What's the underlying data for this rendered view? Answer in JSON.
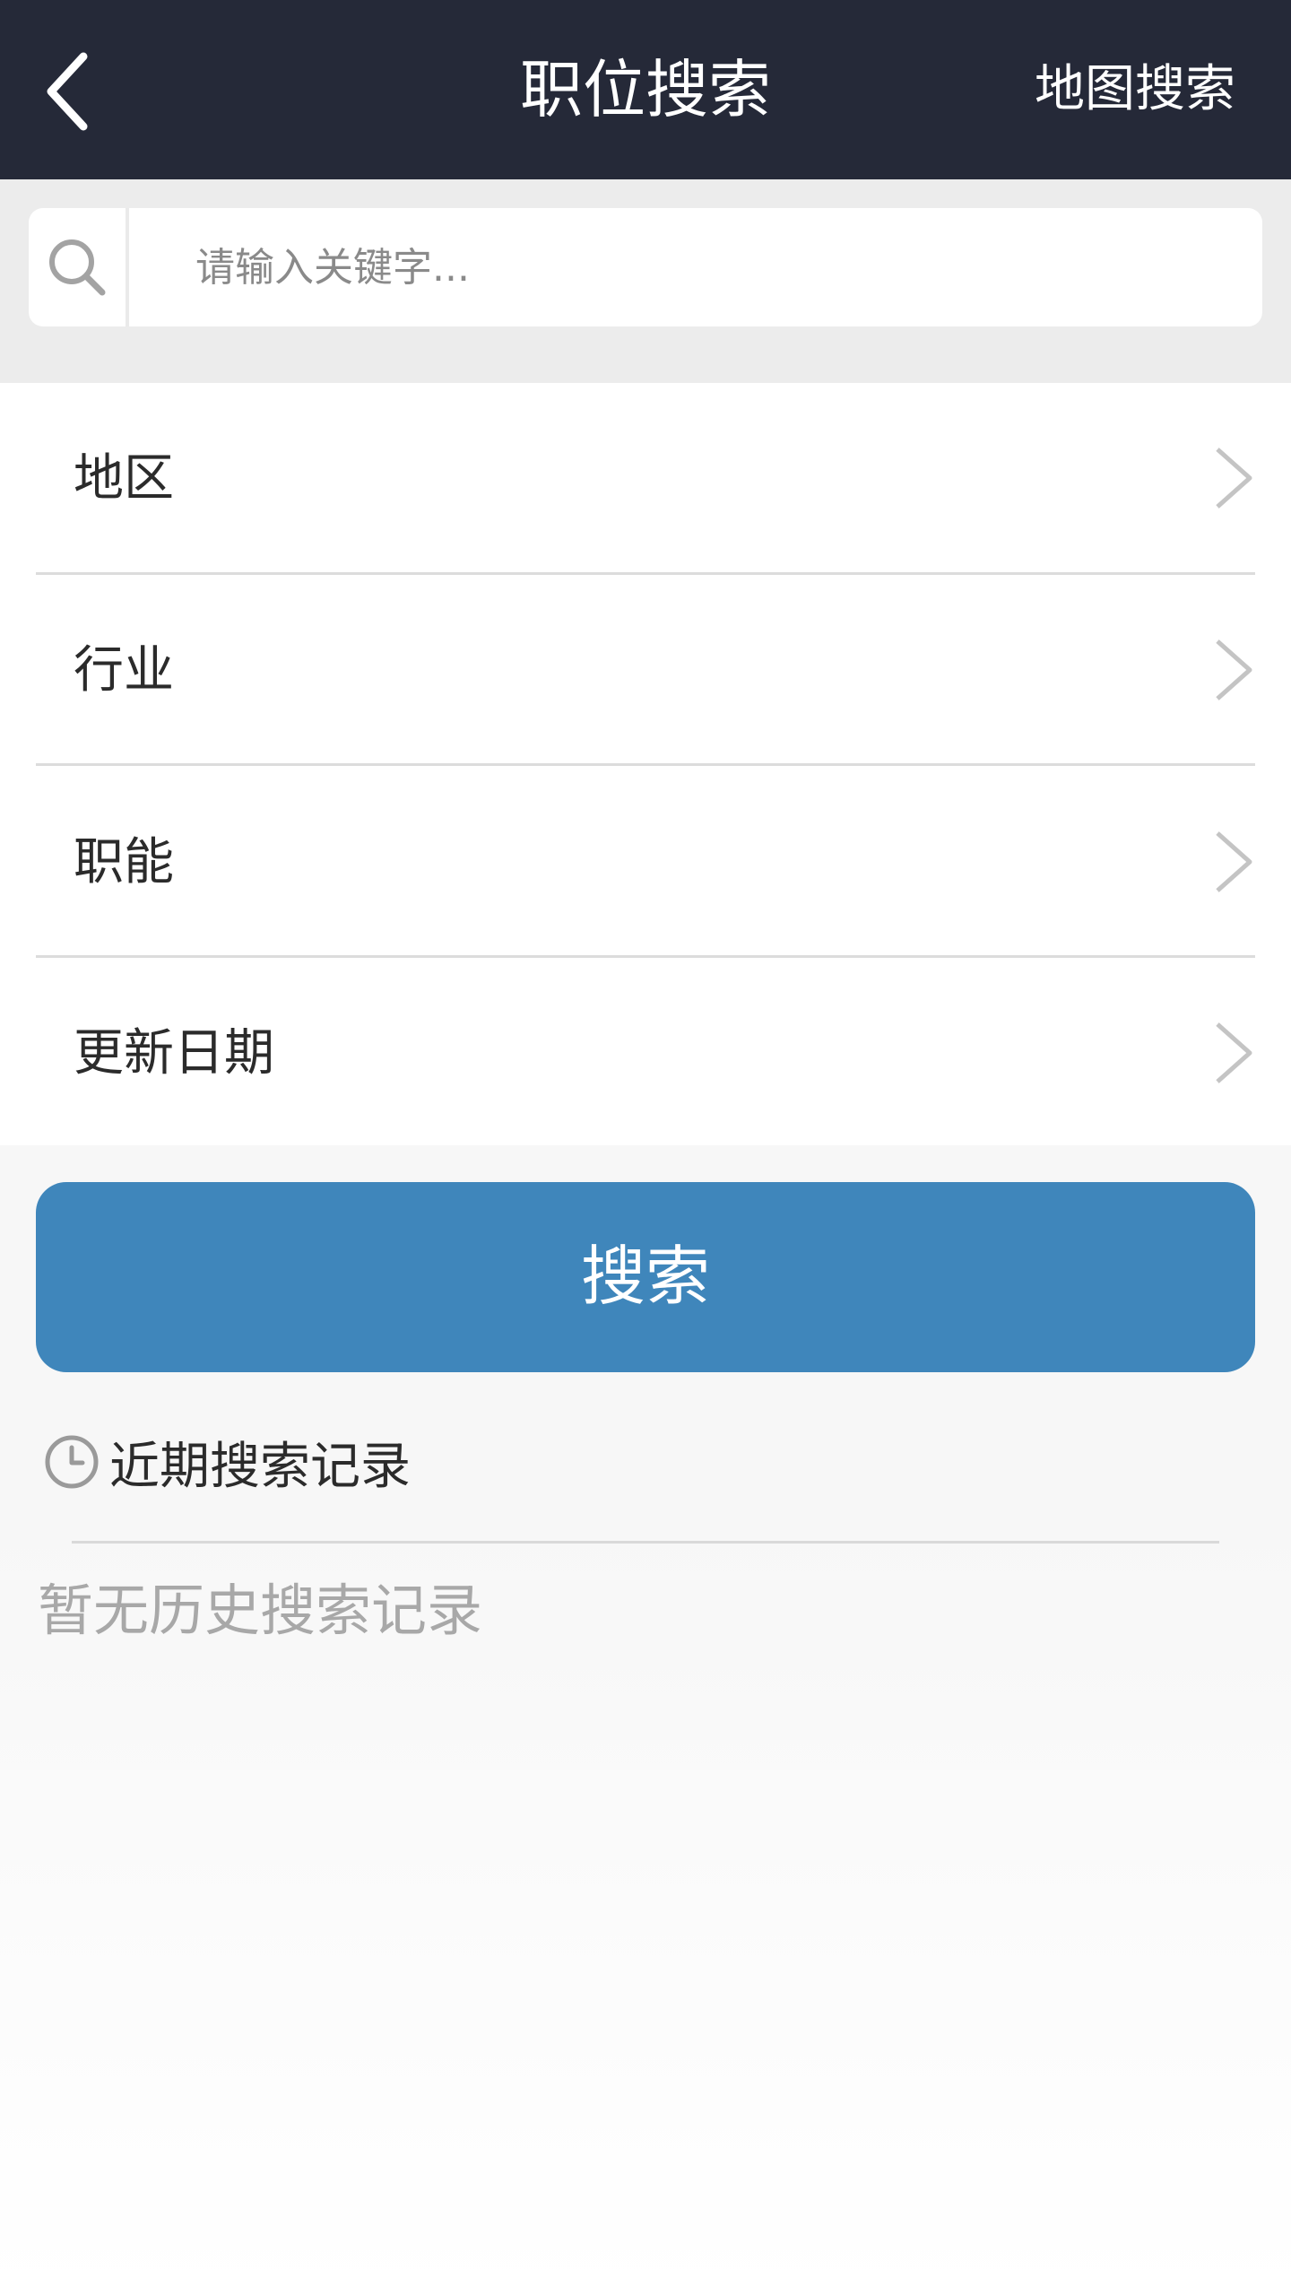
{
  "header": {
    "title": "职位搜索",
    "map_search": "地图搜索",
    "back_icon": "chevron-left-icon"
  },
  "search": {
    "placeholder": "请输入关键字...",
    "value": "",
    "icon": "search-icon"
  },
  "filters": [
    {
      "label": "地区"
    },
    {
      "label": "行业"
    },
    {
      "label": "职能"
    },
    {
      "label": "更新日期"
    }
  ],
  "search_button": {
    "label": "搜索"
  },
  "history": {
    "title": "近期搜索记录",
    "empty": "暂无历史搜索记录",
    "icon": "clock-icon"
  },
  "colors": {
    "header_bg": "#252938",
    "accent": "#3f86bb",
    "page_bg": "#f7f7f7"
  }
}
